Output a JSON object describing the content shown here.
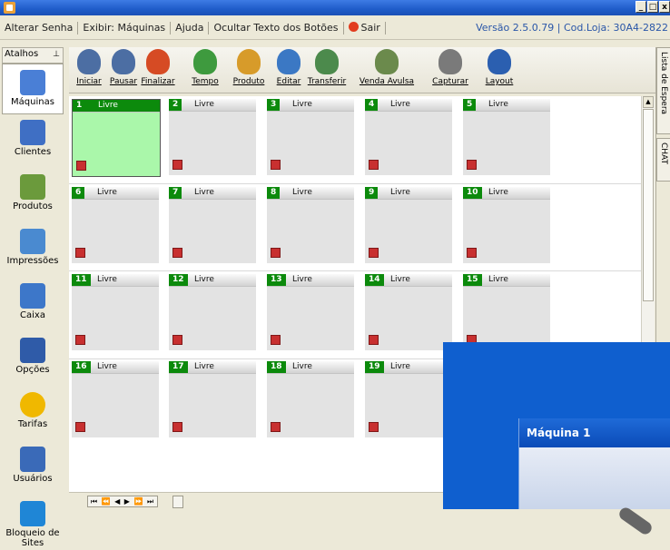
{
  "window": {
    "controls": [
      "_",
      "□",
      "x"
    ]
  },
  "menu": {
    "items": [
      "Alterar Senha",
      "Exibir: Máquinas",
      "Ajuda",
      "Ocultar Texto dos Botões",
      "Sair"
    ],
    "version": "Versão 2.5.0.79  |  Cod.Loja: 30A4-2822"
  },
  "sidebar": {
    "header": "Atalhos",
    "pin": "⊥",
    "items": [
      {
        "label": "Máquinas",
        "icon": "computers-icon",
        "color": "#4a7fd6"
      },
      {
        "label": "Clientes",
        "icon": "client-card-icon",
        "color": "#3f6fc4"
      },
      {
        "label": "Produtos",
        "icon": "shopping-cart-icon",
        "color": "#6b9a3c"
      },
      {
        "label": "Impressões",
        "icon": "printer-icon",
        "color": "#4a8ad0"
      },
      {
        "label": "Caixa",
        "icon": "cash-register-icon",
        "color": "#3d77c9"
      },
      {
        "label": "Opções",
        "icon": "checklist-icon",
        "color": "#2f5ba8"
      },
      {
        "label": "Tarifas",
        "icon": "dollar-coin-icon",
        "color": "#f0b800"
      },
      {
        "label": "Usuários",
        "icon": "users-icon",
        "color": "#3a6ab8"
      },
      {
        "label": "Bloqueio de Sites",
        "icon": "globe-lock-icon",
        "color": "#1f86d6"
      }
    ]
  },
  "toolbar": {
    "buttons": [
      {
        "label": "Iniciar",
        "icon": "start-clock-icon",
        "color": "#4c6ea3"
      },
      {
        "label": "Pausar",
        "icon": "pause-clock-icon",
        "color": "#4c6ea3"
      },
      {
        "label": "Finalizar",
        "icon": "finish-clock-icon",
        "color": "#d64b24"
      },
      {
        "label": "Tempo",
        "icon": "add-time-icon",
        "color": "#3e9a3e"
      },
      {
        "label": "Produto",
        "icon": "add-product-icon",
        "color": "#d79b2a"
      },
      {
        "label": "Editar",
        "icon": "edit-icon",
        "color": "#3b78c4"
      },
      {
        "label": "Transferir",
        "icon": "transfer-icon",
        "color": "#4c8a4c"
      },
      {
        "label": "Venda Avulsa",
        "icon": "cart-sale-icon",
        "color": "#6b8a4c"
      },
      {
        "label": "Capturar",
        "icon": "camera-icon",
        "color": "#7a7a7a"
      },
      {
        "label": "Layout",
        "icon": "layout-grid-icon",
        "color": "#2b5fb0"
      }
    ]
  },
  "machines": [
    {
      "num": "1",
      "status": "Livre",
      "active": true
    },
    {
      "num": "2",
      "status": "Livre"
    },
    {
      "num": "3",
      "status": "Livre"
    },
    {
      "num": "4",
      "status": "Livre"
    },
    {
      "num": "5",
      "status": "Livre"
    },
    {
      "num": "6",
      "status": "Livre"
    },
    {
      "num": "7",
      "status": "Livre"
    },
    {
      "num": "8",
      "status": "Livre"
    },
    {
      "num": "9",
      "status": "Livre"
    },
    {
      "num": "10",
      "status": "Livre"
    },
    {
      "num": "11",
      "status": "Livre"
    },
    {
      "num": "12",
      "status": "Livre"
    },
    {
      "num": "13",
      "status": "Livre"
    },
    {
      "num": "14",
      "status": "Livre"
    },
    {
      "num": "15",
      "status": "Livre"
    },
    {
      "num": "16",
      "status": "Livre"
    },
    {
      "num": "17",
      "status": "Livre"
    },
    {
      "num": "18",
      "status": "Livre"
    },
    {
      "num": "19",
      "status": "Livre"
    }
  ],
  "rightTabs": [
    "Lista de Espera",
    "CHAT"
  ],
  "hscroll": {
    "nav": "⏮ ⏪ ◀ ▶ ⏩ ⏭"
  },
  "popup": {
    "title": "Máquina 1"
  }
}
